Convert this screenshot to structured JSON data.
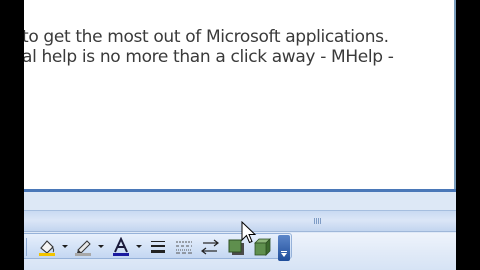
{
  "document": {
    "line1": "to get the most out of Microsoft applications.",
    "line2": "al help is no more than a click away - MHelp -"
  },
  "toolbar": {
    "buttons": [
      {
        "icon": "fill-color-icon",
        "has_dropdown": true
      },
      {
        "icon": "line-color-icon",
        "has_dropdown": true
      },
      {
        "icon": "font-color-icon",
        "has_dropdown": true,
        "glyph": "A"
      },
      {
        "icon": "line-style-icon"
      },
      {
        "icon": "dash-style-icon"
      },
      {
        "icon": "arrow-style-icon"
      },
      {
        "icon": "shadow-style-icon"
      },
      {
        "icon": "3d-style-icon"
      },
      {
        "icon": "toolbar-options-icon"
      }
    ]
  },
  "colors": {
    "document_bg": "#ffffff",
    "text": "#3a3a3a",
    "toolbar_bg": "#d6e3f5",
    "accent_blue": "#1f4d9a",
    "font_color_bar": "#1a1aa0"
  }
}
